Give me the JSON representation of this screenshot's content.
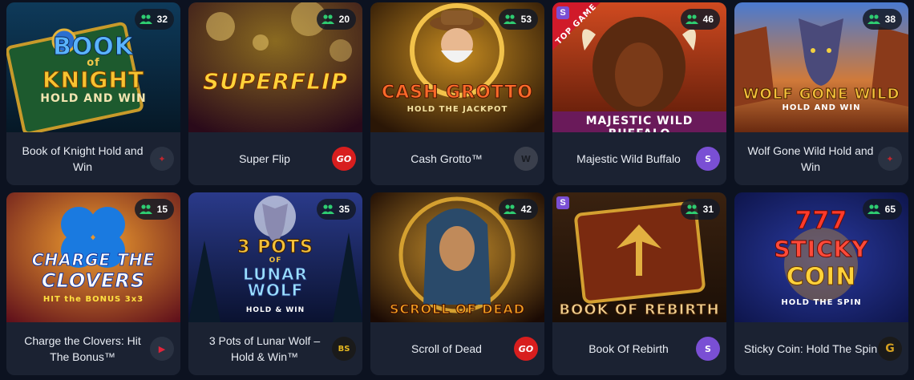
{
  "games": [
    {
      "title": "Book of Knight Hold and Win",
      "players": "32",
      "provider_icon": "provider-red-icon",
      "provider_glyph": "✦",
      "provider_color": "#c0262e",
      "art": {
        "line1": "BOOK",
        "line2": "of",
        "line3": "KNIGHT",
        "line4": "HOLD AND WIN"
      }
    },
    {
      "title": "Super Flip",
      "players": "20",
      "provider_icon": "provider-go-icon",
      "provider_glyph": "GO",
      "provider_color": "#d81e1e",
      "art": {
        "line1": "SUPERFLIP"
      }
    },
    {
      "title": "Cash Grotto™",
      "players": "53",
      "provider_icon": "provider-w-icon",
      "provider_glyph": "W",
      "provider_color": "#4a4f5c",
      "art": {
        "line1": "CASH GROTTO",
        "line2": "HOLD THE JACKPOT"
      }
    },
    {
      "title": "Majestic Wild Buffalo",
      "players": "46",
      "provider_icon": "provider-s-icon",
      "provider_glyph": "S",
      "provider_color": "#7a4fd4",
      "art": {
        "line1": "MAJESTIC WILD BUFFALO",
        "badge": "TOP GAME"
      }
    },
    {
      "title": "Wolf Gone Wild Hold and Win",
      "players": "38",
      "provider_icon": "provider-red-icon",
      "provider_glyph": "✦",
      "provider_color": "#c0262e",
      "art": {
        "line1": "WOLF GONE WILD",
        "line2": "HOLD AND WIN"
      }
    },
    {
      "title": "Charge the Clovers: Hit The Bonus™",
      "players": "15",
      "provider_icon": "provider-play-icon",
      "provider_glyph": "▶",
      "provider_color": "#e0243a",
      "art": {
        "line1": "CHARGE THE",
        "line2": "CLOVERS",
        "line3": "HIT the BONUS 3x3"
      }
    },
    {
      "title": "3 Pots of Lunar Wolf – Hold & Win™",
      "players": "35",
      "provider_icon": "provider-bs-icon",
      "provider_glyph": "BS",
      "provider_color": "#e6b820",
      "art": {
        "line1": "3 POTS",
        "line2": "OF",
        "line3": "LUNAR",
        "line4": "WOLF",
        "line5": "HOLD & WIN"
      }
    },
    {
      "title": "Scroll of Dead",
      "players": "42",
      "provider_icon": "provider-go-icon",
      "provider_glyph": "GO",
      "provider_color": "#d81e1e",
      "art": {
        "line1": "SCROLL OF DEAD"
      }
    },
    {
      "title": "Book Of Rebirth",
      "players": "31",
      "provider_icon": "provider-s-icon",
      "provider_glyph": "S",
      "provider_color": "#7a4fd4",
      "art": {
        "line1": "BOOK OF REBIRTH"
      }
    },
    {
      "title": "Sticky Coin: Hold The Spin",
      "players": "65",
      "provider_icon": "provider-g-icon",
      "provider_glyph": "G",
      "provider_color": "#d4a020",
      "art": {
        "line1": "777",
        "line2": "STICKY",
        "line3": "COIN",
        "line4": "HOLD THE SPIN"
      }
    }
  ]
}
